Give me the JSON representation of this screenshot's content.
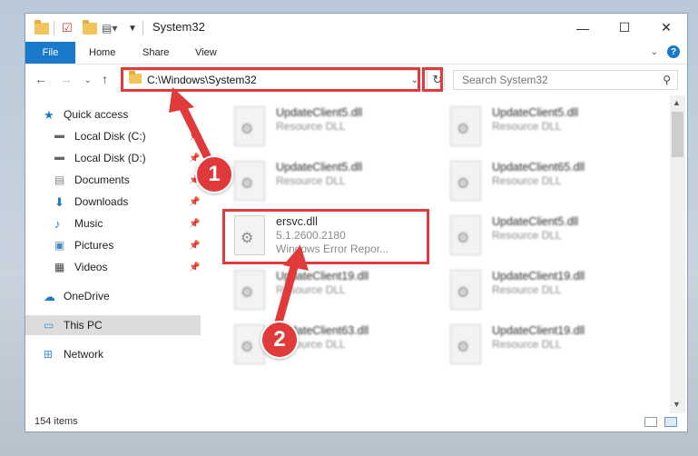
{
  "window": {
    "title": "System32"
  },
  "ribbon": {
    "file": "File",
    "home": "Home",
    "share": "Share",
    "view": "View",
    "help": "?"
  },
  "address": {
    "path": "C:\\Windows\\System32"
  },
  "search": {
    "placeholder": "Search System32"
  },
  "sidebar": {
    "items": [
      {
        "label": "Quick access"
      },
      {
        "label": "Local Disk (C:)"
      },
      {
        "label": "Local Disk (D:)"
      },
      {
        "label": "Documents"
      },
      {
        "label": "Downloads"
      },
      {
        "label": "Music"
      },
      {
        "label": "Pictures"
      },
      {
        "label": "Videos"
      },
      {
        "label": "OneDrive"
      },
      {
        "label": "This PC"
      },
      {
        "label": "Network"
      }
    ]
  },
  "files": [
    {
      "name": "UpdateClient5.dll",
      "desc": "Resource DLL"
    },
    {
      "name": "UpdateClient5.dll",
      "desc": "Resource DLL"
    },
    {
      "name": "UpdateClient5.dll",
      "desc": "Resource DLL"
    },
    {
      "name": "UpdateClient65.dll",
      "desc": "Resource DLL"
    },
    {
      "name": "ersvc.dll",
      "version": "5.1.2600.2180",
      "desc": "Windows Error Repor..."
    },
    {
      "name": "UpdateClient5.dll",
      "desc": "Resource DLL"
    },
    {
      "name": "UpdateClient19.dll",
      "desc": "Resource DLL"
    },
    {
      "name": "UpdateClient19.dll",
      "desc": "Resource DLL"
    },
    {
      "name": "UpdateClient63.dll",
      "desc": "Resource DLL"
    },
    {
      "name": "UpdateClient19.dll",
      "desc": "Resource DLL"
    }
  ],
  "status": {
    "item_count": "154 items"
  },
  "callouts": {
    "one": "1",
    "two": "2"
  },
  "colors": {
    "accent": "#1979ca",
    "highlight": "#e03a3a"
  }
}
